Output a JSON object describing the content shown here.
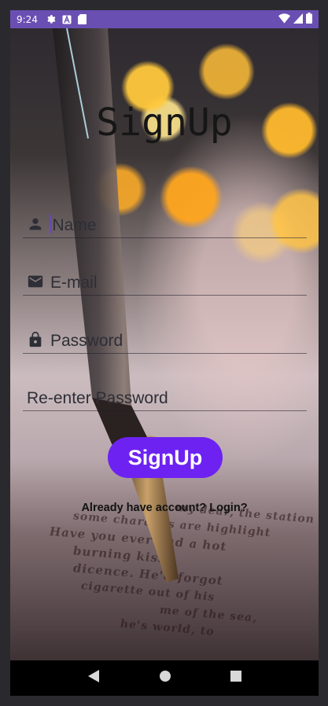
{
  "status_bar": {
    "time": "9:24",
    "icons": [
      "gear-icon",
      "a-icon",
      "sd-card-icon",
      "wifi-icon",
      "signal-icon",
      "battery-icon"
    ],
    "color": "#6a4fb3"
  },
  "page": {
    "title": "SignUp"
  },
  "form": {
    "name": {
      "placeholder": "Name",
      "icon": "person-icon"
    },
    "email": {
      "placeholder": "E-mail",
      "icon": "mail-icon"
    },
    "password": {
      "placeholder": "Password",
      "icon": "lock-icon"
    },
    "reenter_password": {
      "placeholder": "Re-enter Password"
    }
  },
  "actions": {
    "signup_label": "SignUp",
    "signup_color": "#6d22f2",
    "login_link": "Already have account? Login?"
  },
  "background": {
    "paper_lines": [
      "my dear, the station",
      "some charades are highlight",
      "Have you ever had a hot",
      "burning kiss?",
      "dicence. He'd forgot",
      "cigarette out of his",
      "me of the sea,",
      "he's world, to"
    ]
  },
  "nav_bar": {
    "buttons": [
      "back-icon",
      "home-icon",
      "recents-icon"
    ]
  }
}
